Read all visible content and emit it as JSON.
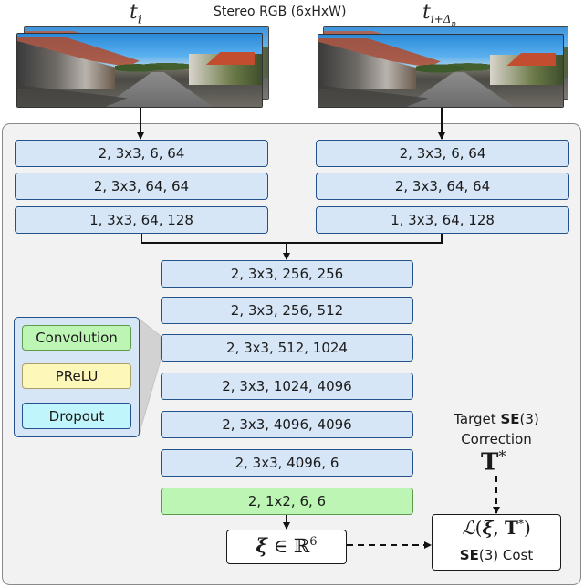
{
  "header": {
    "input_left_label": "t",
    "input_left_sub": "i",
    "title": "Stereo RGB (6xHxW)",
    "input_right_label": "t",
    "input_right_sub": "i+Δ",
    "input_right_subsub": "p"
  },
  "images": {
    "left": {
      "icon": "stereo-image-pair",
      "description": "street scene frame at t_i"
    },
    "right": {
      "icon": "stereo-image-pair",
      "description": "street scene frame at t_{i+Δp}"
    }
  },
  "left_branch": [
    "2, 3x3, 6, 64",
    "2, 3x3, 64, 64",
    "1, 3x3, 64, 128"
  ],
  "right_branch": [
    "2, 3x3, 6, 64",
    "2, 3x3, 64, 64",
    "1, 3x3, 64, 128"
  ],
  "trunk": [
    "2, 3x3, 256, 256",
    "2, 3x3, 256, 512",
    "2, 3x3, 512, 1024",
    "2, 3x3, 1024, 4096",
    "2, 3x3, 4096, 4096",
    "2, 3x3, 4096, 6"
  ],
  "final_layer": "2, 1x2, 6, 6",
  "legend": {
    "items": [
      "Convolution",
      "PReLU",
      "Dropout"
    ],
    "colors": [
      "#bdf5b5",
      "#fdf7b9",
      "#bff5fb"
    ]
  },
  "output": {
    "xi": "ξ",
    "in": "∈",
    "space": "ℝ",
    "power": "6"
  },
  "target": {
    "line1_prefix": "Target ",
    "line1_group": "SE",
    "line1_suffix": "(3)",
    "line2": "Correction",
    "symbol": "T",
    "symbol_sup": "*"
  },
  "loss": {
    "formula_L": "ℒ",
    "formula_open": "(",
    "formula_xi": "ξ",
    "formula_sep": ", ",
    "formula_T": "T",
    "formula_sup": "*",
    "formula_close": ")",
    "label_group": "SE",
    "label_suffix": "(3) Cost"
  },
  "colors": {
    "block_fill": "#d6e6f6",
    "block_border": "#24528a",
    "final_fill": "#bdf5b5",
    "panel_fill": "#f2f2f2"
  }
}
